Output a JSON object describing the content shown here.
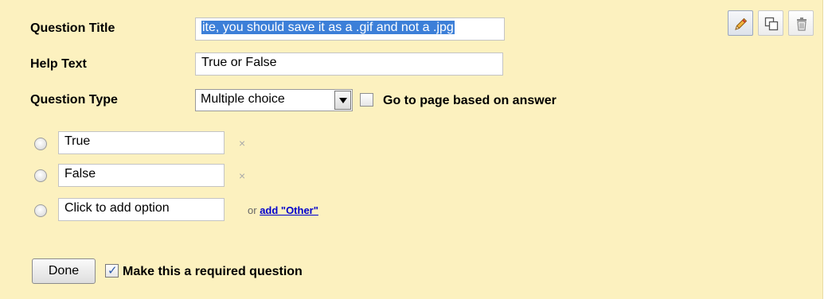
{
  "question": {
    "title_label": "Question Title",
    "title_value": "ite, you should save it as a .gif and not a .jpg",
    "help_label": "Help Text",
    "help_value": "True or False",
    "type_label": "Question Type",
    "type_value": "Multiple choice",
    "goto_page_label": "Go to page based on answer",
    "goto_page_checked": false
  },
  "options": [
    {
      "value": "True",
      "remove": "×"
    },
    {
      "value": "False",
      "remove": "×"
    }
  ],
  "add_option": {
    "placeholder": "Click to add option",
    "or_text": "or",
    "other_link": "add \"Other\""
  },
  "footer": {
    "done_label": "Done",
    "required_label": "Make this a required question",
    "required_checked": true
  },
  "toolbar": {
    "edit_icon": "pencil-icon",
    "duplicate_icon": "duplicate-icon",
    "delete_icon": "trash-icon"
  },
  "colors": {
    "panel_bg": "#fcf1bf",
    "selection": "#3c7fd8",
    "link": "#0000cc"
  }
}
